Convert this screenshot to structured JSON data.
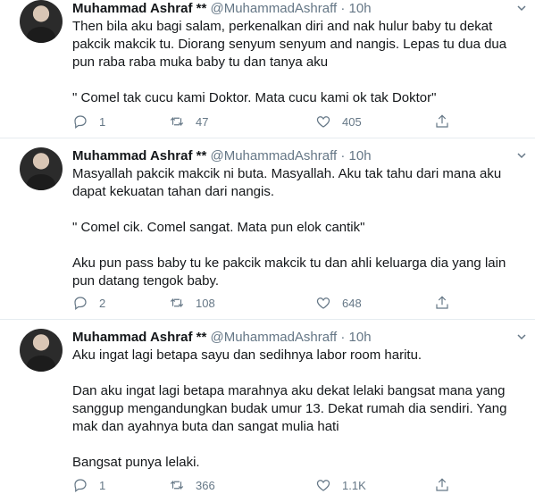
{
  "tweets": [
    {
      "name": "Muhammad Ashraf **",
      "handle": "@MuhammadAshraff",
      "dot": "·",
      "time": "10h",
      "paragraphs": [
        "Then bila aku bagi salam, perkenalkan diri and nak hulur baby tu dekat pakcik makcik tu. Diorang senyum senyum and nangis. Lepas tu dua dua pun raba raba muka baby tu dan tanya aku",
        "\" Comel tak cucu kami Doktor. Mata cucu kami ok tak Doktor\""
      ],
      "replies": "1",
      "retweets": "47",
      "likes": "405"
    },
    {
      "name": "Muhammad Ashraf **",
      "handle": "@MuhammadAshraff",
      "dot": "·",
      "time": "10h",
      "paragraphs": [
        "Masyallah pakcik makcik ni buta. Masyallah. Aku tak tahu dari mana aku dapat kekuatan tahan dari nangis.",
        "\" Comel cik. Comel sangat. Mata pun elok cantik\"",
        "Aku pun pass baby tu ke pakcik makcik tu dan ahli keluarga dia yang lain pun datang tengok baby."
      ],
      "replies": "2",
      "retweets": "108",
      "likes": "648"
    },
    {
      "name": "Muhammad Ashraf **",
      "handle": "@MuhammadAshraff",
      "dot": "·",
      "time": "10h",
      "paragraphs": [
        "Aku ingat lagi betapa sayu dan sedihnya labor room haritu.",
        "Dan aku ingat lagi betapa marahnya aku dekat lelaki bangsat mana yang sanggup mengandungkan budak umur 13. Dekat rumah dia sendiri. Yang mak dan ayahnya buta dan sangat mulia hati",
        "Bangsat punya lelaki."
      ],
      "replies": "1",
      "retweets": "366",
      "likes": "1.1K"
    }
  ],
  "icons": {
    "reply": "reply-icon",
    "retweet": "retweet-icon",
    "like": "heart-icon",
    "share": "share-icon",
    "caret": "chevron-down-icon"
  },
  "colors": {
    "text": "#14171a",
    "secondary": "#657786",
    "border": "#e6ecf0"
  }
}
